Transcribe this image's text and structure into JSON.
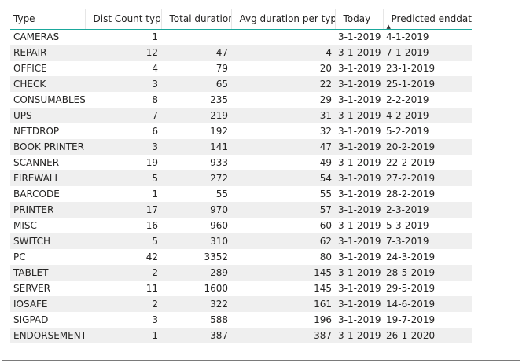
{
  "table": {
    "headers": [
      "Type",
      "_Dist Count type",
      "_Total duration",
      "_Avg duration per type",
      "_Today",
      "_Predicted enddate"
    ],
    "sort_column": 5,
    "rows": [
      [
        "CAMERAS",
        "1",
        "",
        "",
        "3-1-2019",
        "4-1-2019"
      ],
      [
        "REPAIR",
        "12",
        "47",
        "4",
        "3-1-2019",
        "7-1-2019"
      ],
      [
        "OFFICE",
        "4",
        "79",
        "20",
        "3-1-2019",
        "23-1-2019"
      ],
      [
        "CHECK",
        "3",
        "65",
        "22",
        "3-1-2019",
        "25-1-2019"
      ],
      [
        "CONSUMABLES",
        "8",
        "235",
        "29",
        "3-1-2019",
        "2-2-2019"
      ],
      [
        "UPS",
        "7",
        "219",
        "31",
        "3-1-2019",
        "4-2-2019"
      ],
      [
        "NETDROP",
        "6",
        "192",
        "32",
        "3-1-2019",
        "5-2-2019"
      ],
      [
        "BOOK PRINTER",
        "3",
        "141",
        "47",
        "3-1-2019",
        "20-2-2019"
      ],
      [
        "SCANNER",
        "19",
        "933",
        "49",
        "3-1-2019",
        "22-2-2019"
      ],
      [
        "FIREWALL",
        "5",
        "272",
        "54",
        "3-1-2019",
        "27-2-2019"
      ],
      [
        "BARCODE",
        "1",
        "55",
        "55",
        "3-1-2019",
        "28-2-2019"
      ],
      [
        "PRINTER",
        "17",
        "970",
        "57",
        "3-1-2019",
        "2-3-2019"
      ],
      [
        "MISC",
        "16",
        "960",
        "60",
        "3-1-2019",
        "5-3-2019"
      ],
      [
        "SWITCH",
        "5",
        "310",
        "62",
        "3-1-2019",
        "7-3-2019"
      ],
      [
        "PC",
        "42",
        "3352",
        "80",
        "3-1-2019",
        "24-3-2019"
      ],
      [
        "TABLET",
        "2",
        "289",
        "145",
        "3-1-2019",
        "28-5-2019"
      ],
      [
        "SERVER",
        "11",
        "1600",
        "145",
        "3-1-2019",
        "29-5-2019"
      ],
      [
        "IOSAFE",
        "2",
        "322",
        "161",
        "3-1-2019",
        "14-6-2019"
      ],
      [
        "SIGPAD",
        "3",
        "588",
        "196",
        "3-1-2019",
        "19-7-2019"
      ],
      [
        "ENDORSEMENT",
        "1",
        "387",
        "387",
        "3-1-2019",
        "26-1-2020"
      ]
    ]
  },
  "colors": {
    "header_underline": "#1aa89c",
    "stripe": "#efefef",
    "frame_border": "#7a7a7a"
  },
  "icons": {
    "sort": "sort-ascending-icon"
  }
}
